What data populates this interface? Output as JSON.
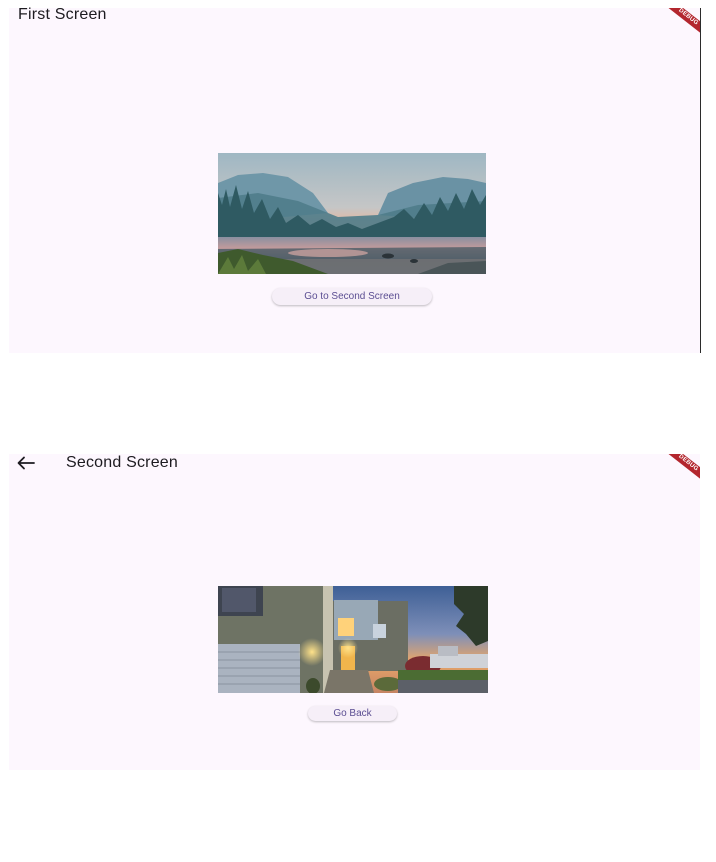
{
  "first_screen": {
    "title": "First Screen",
    "debug_label": "DEBUG",
    "button_label": "Go to Second Screen"
  },
  "second_screen": {
    "title": "Second Screen",
    "debug_label": "DEBUG",
    "button_label": "Go Back",
    "back_icon": "arrow-back-icon"
  },
  "colors": {
    "background": "#fdf7fe",
    "button_text": "#5b4e92",
    "button_bg": "#f6eff8",
    "debug_banner": "#b3262e",
    "title_text": "#1d1b20"
  }
}
